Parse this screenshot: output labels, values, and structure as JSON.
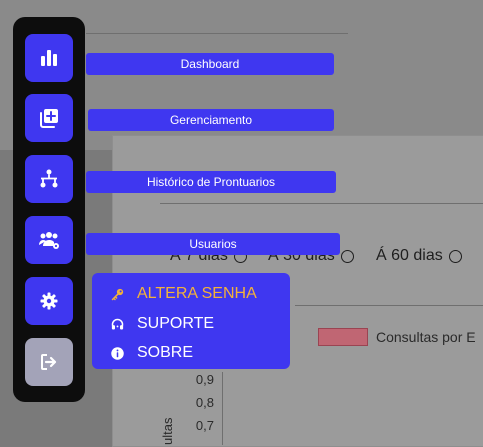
{
  "background": {
    "range_options": [
      "Á 7 dias",
      "Á 30 dias",
      "Á 60 dias"
    ],
    "legend_label": "Consultas por E",
    "y_ticks": [
      "0,9",
      "0,8",
      "0,7"
    ],
    "y_axis_label": "ultas"
  },
  "sidebar": {
    "items": [
      {
        "label": "Dashboard",
        "icon": "bar-chart-icon"
      },
      {
        "label": "Gerenciamento",
        "icon": "add-copy-icon"
      },
      {
        "label": "Histórico de Prontuarios",
        "icon": "flow-icon"
      },
      {
        "label": "Usuarios",
        "icon": "users-settings-icon"
      },
      {
        "label": "",
        "icon": "gear-icon"
      },
      {
        "label": "",
        "icon": "logout-icon"
      }
    ]
  },
  "settings_menu": {
    "items": [
      {
        "label": "ALTERA SENHA",
        "icon": "key-icon",
        "active": true
      },
      {
        "label": "SUPORTE",
        "icon": "headset-icon",
        "active": false
      },
      {
        "label": "SOBRE",
        "icon": "info-icon",
        "active": false
      }
    ]
  },
  "colors": {
    "accent": "#3f37f0",
    "active_menu_text": "#f3b23a",
    "sidebar_bg": "#0d0d0d",
    "logout_button": "#a3a3b8"
  }
}
